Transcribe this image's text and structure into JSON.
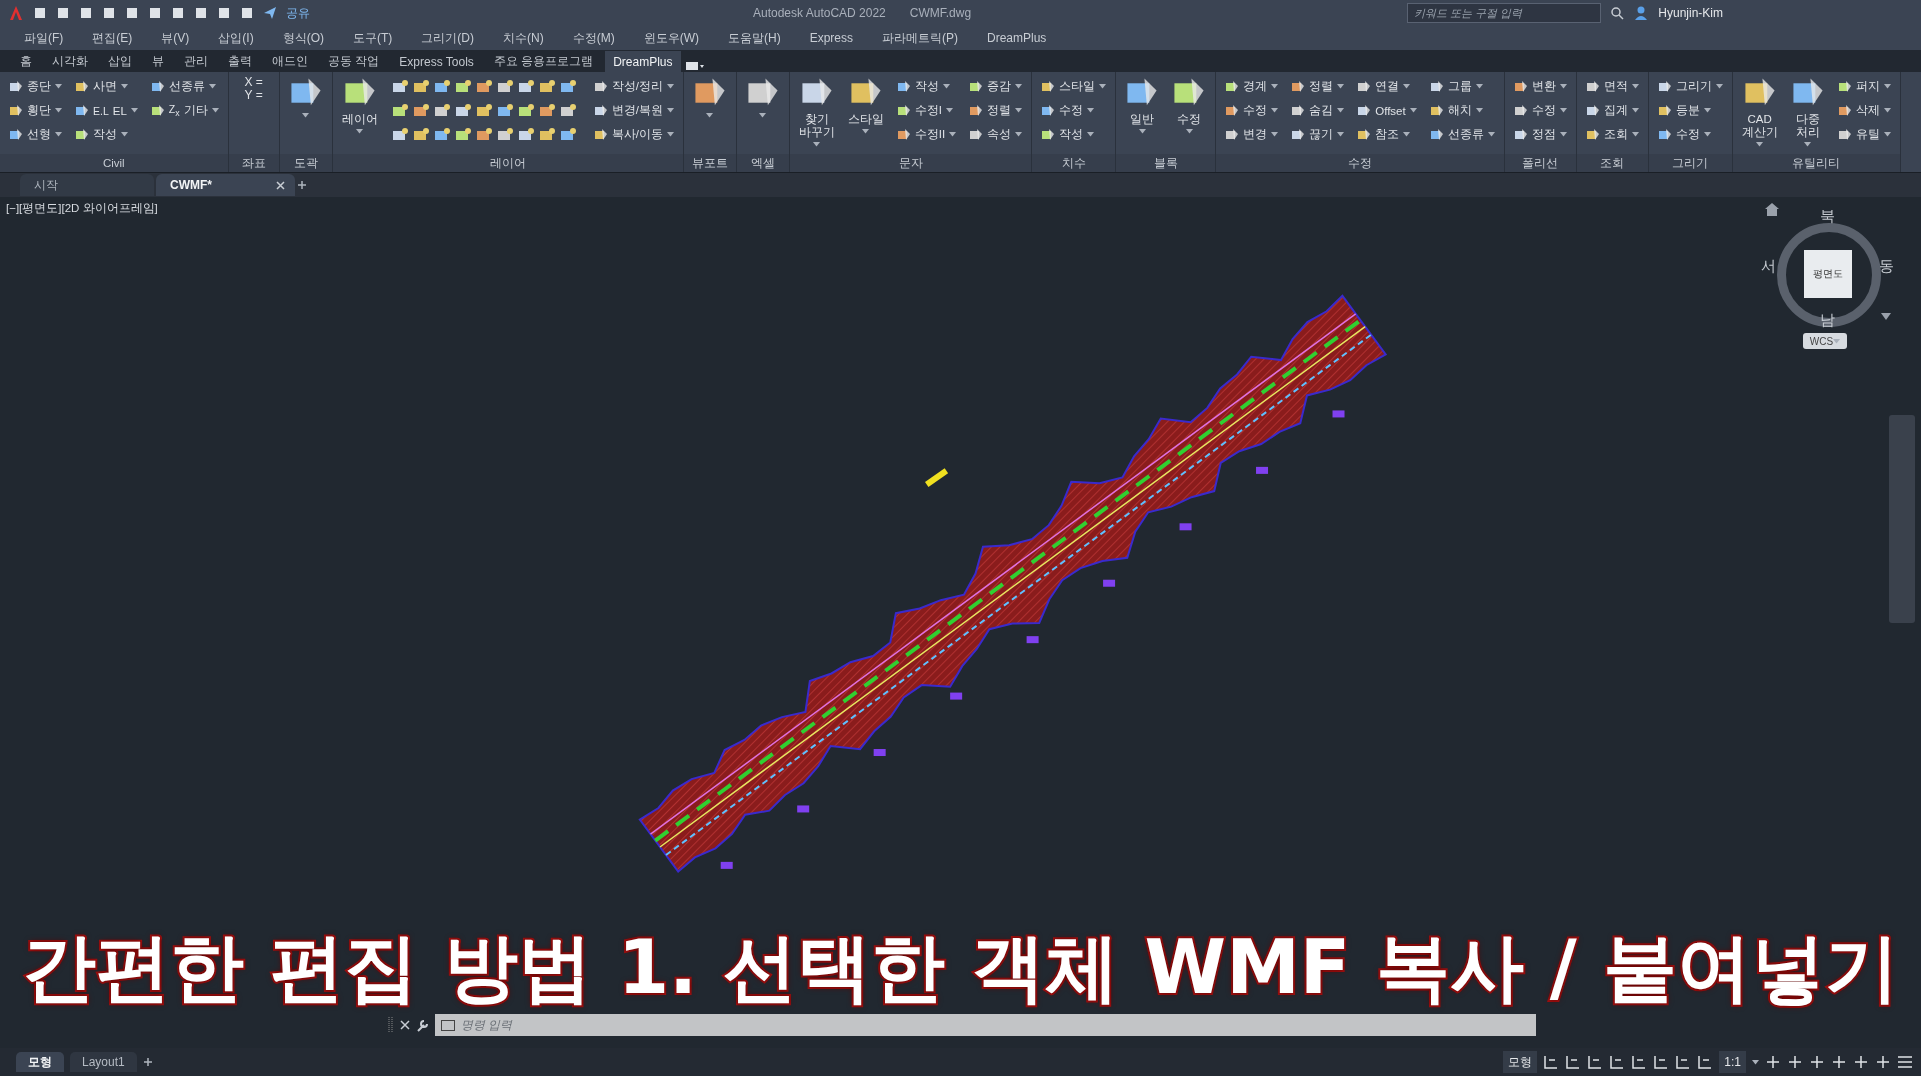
{
  "titlebar": {
    "share": "공유",
    "app_title": "Autodesk AutoCAD 2022",
    "file_name": "CWMF.dwg",
    "search": {
      "placeholder": "키워드 또는 구절 입력"
    },
    "user": "Hyunjin-Kim"
  },
  "menu": [
    "파일(F)",
    "편집(E)",
    "뷰(V)",
    "삽입(I)",
    "형식(O)",
    "도구(T)",
    "그리기(D)",
    "치수(N)",
    "수정(M)",
    "윈도우(W)",
    "도움말(H)",
    "Express",
    "파라메트릭(P)",
    "DreamPlus"
  ],
  "ribbon_tabs": [
    {
      "label": "홈",
      "selected": false
    },
    {
      "label": "시각화",
      "selected": false
    },
    {
      "label": "삽입",
      "selected": false
    },
    {
      "label": "뷰",
      "selected": false
    },
    {
      "label": "관리",
      "selected": false
    },
    {
      "label": "출력",
      "selected": false
    },
    {
      "label": "애드인",
      "selected": false
    },
    {
      "label": "공동 작업",
      "selected": false
    },
    {
      "label": "Express Tools",
      "selected": false
    },
    {
      "label": "주요 응용프로그램",
      "selected": false
    },
    {
      "label": "DreamPlus",
      "selected": true
    }
  ],
  "ribbon_panels": [
    {
      "title": "Civil",
      "columns": [
        {
          "kind": "stack",
          "items": [
            {
              "label": "종단"
            },
            {
              "label": "횡단"
            },
            {
              "label": "선형"
            }
          ]
        },
        {
          "kind": "stack",
          "items": [
            {
              "label": "사면"
            },
            {
              "glyph": "E.L",
              "label": "EL"
            },
            {
              "label": "작성"
            }
          ]
        },
        {
          "kind": "stack",
          "items": [
            {
              "label": "선종류"
            },
            {
              "glyph": "Z$_{x}$",
              "label": "기타"
            }
          ]
        }
      ]
    },
    {
      "title": "좌표",
      "columns": [
        {
          "kind": "coords",
          "lines": [
            "X =",
            "Y ="
          ]
        }
      ]
    },
    {
      "title": "도곽",
      "columns": [
        {
          "kind": "large"
        }
      ]
    },
    {
      "title": "레이어",
      "columns": [
        {
          "kind": "large",
          "label": "레이어"
        },
        {
          "kind": "icon_grid"
        },
        {
          "kind": "stack",
          "items": [
            {
              "label": "작성/정리"
            },
            {
              "label": "변경/복원"
            },
            {
              "label": "복사/이동"
            }
          ]
        }
      ]
    },
    {
      "title": "뷰포트",
      "columns": [
        {
          "kind": "large"
        }
      ]
    },
    {
      "title": "엑셀",
      "columns": [
        {
          "kind": "large"
        }
      ]
    },
    {
      "title": "문자",
      "columns": [
        {
          "kind": "large",
          "label": "찾기\n바꾸기"
        },
        {
          "kind": "large",
          "label": "스타일"
        },
        {
          "kind": "stack",
          "items": [
            {
              "label": "작성"
            },
            {
              "label": "수정I"
            },
            {
              "label": "수정II"
            }
          ]
        },
        {
          "kind": "stack",
          "items": [
            {
              "label": "증감"
            },
            {
              "label": "정렬"
            },
            {
              "label": "속성"
            }
          ]
        }
      ]
    },
    {
      "title": "치수",
      "columns": [
        {
          "kind": "stack",
          "items": [
            {
              "label": "스타일"
            },
            {
              "label": "수정"
            },
            {
              "label": "작성"
            }
          ]
        }
      ]
    },
    {
      "title": "블록",
      "columns": [
        {
          "kind": "large",
          "label": "일반"
        },
        {
          "kind": "large",
          "label": "수정"
        }
      ]
    },
    {
      "title": "수정",
      "columns": [
        {
          "kind": "stack",
          "items": [
            {
              "label": "경계"
            },
            {
              "label": "수정"
            },
            {
              "label": "변경"
            }
          ]
        },
        {
          "kind": "stack",
          "items": [
            {
              "label": "정렬"
            },
            {
              "label": "숨김"
            },
            {
              "label": "끊기"
            }
          ]
        },
        {
          "kind": "stack",
          "items": [
            {
              "label": "연결"
            },
            {
              "label": "Offset"
            },
            {
              "label": "참조"
            }
          ]
        },
        {
          "kind": "stack",
          "items": [
            {
              "label": "그룹"
            },
            {
              "label": "해치"
            },
            {
              "label": "선종류"
            }
          ]
        }
      ]
    },
    {
      "title": "폴리선",
      "columns": [
        {
          "kind": "stack",
          "items": [
            {
              "label": "변환"
            },
            {
              "label": "수정"
            },
            {
              "label": "정점"
            }
          ]
        }
      ]
    },
    {
      "title": "조회",
      "columns": [
        {
          "kind": "stack",
          "items": [
            {
              "label": "면적"
            },
            {
              "label": "집계"
            },
            {
              "label": "조회"
            }
          ]
        }
      ]
    },
    {
      "title": "그리기",
      "columns": [
        {
          "kind": "stack",
          "items": [
            {
              "label": "그리기"
            },
            {
              "label": "등분"
            },
            {
              "label": "수정"
            }
          ]
        }
      ]
    },
    {
      "title": "유틸리티",
      "columns": [
        {
          "kind": "large",
          "label": "CAD\n계산기"
        },
        {
          "kind": "large",
          "label": "다중\n처리"
        },
        {
          "kind": "stack",
          "items": [
            {
              "label": "퍼지"
            },
            {
              "label": "삭제"
            },
            {
              "label": "유틸"
            }
          ]
        }
      ]
    }
  ],
  "doc_tabs": [
    {
      "label": "시작",
      "selected": false
    },
    {
      "label": "CWMF*",
      "selected": true
    }
  ],
  "viewport": {
    "label": "[−][평면도][2D 와이어프레임]",
    "viewcube": {
      "north": "북",
      "south": "남",
      "west": "서",
      "east": "동",
      "face": "평면도",
      "ucs": "WCS"
    }
  },
  "caption": "간편한 편집 방법 1. 선택한 객체 WMF 복사 / 붙여넣기",
  "command_line": {
    "placeholder": "명령 입력"
  },
  "layout_tabs": [
    {
      "label": "모형",
      "selected": true
    },
    {
      "label": "Layout1",
      "selected": false
    }
  ],
  "status_bar": {
    "space": "모형",
    "scale": "1:1"
  }
}
